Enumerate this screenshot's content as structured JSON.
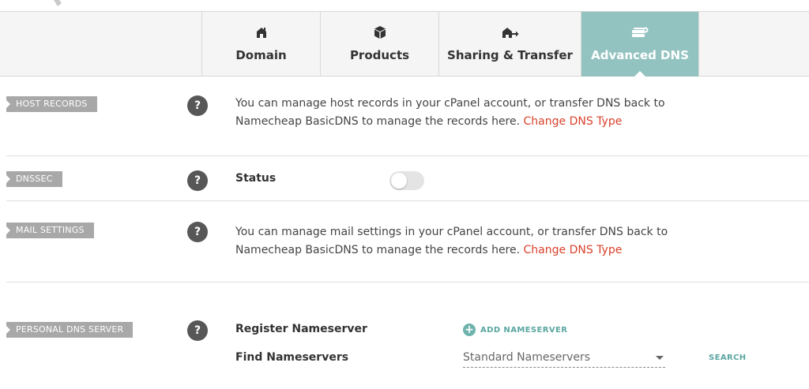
{
  "tabs": [
    {
      "label": "Domain",
      "icon": "house-icon"
    },
    {
      "label": "Products",
      "icon": "box-icon"
    },
    {
      "label": "Sharing & Transfer",
      "icon": "house-arrow-icon"
    },
    {
      "label": "Advanced DNS",
      "icon": "server-icon",
      "active": true
    }
  ],
  "host_records": {
    "tag": "HOST RECORDS",
    "help": "?",
    "text": "You can manage host records in your cPanel account, or transfer DNS back to Namecheap BasicDNS to manage the records here. ",
    "link": "Change DNS Type"
  },
  "dnssec": {
    "tag": "DNSSEC",
    "help": "?",
    "status_label": "Status",
    "enabled": false
  },
  "mail_settings": {
    "tag": "MAIL SETTINGS",
    "help": "?",
    "text": "You can manage mail settings in your cPanel account, or transfer DNS back to Namecheap BasicDNS to manage the records here. ",
    "link": "Change DNS Type"
  },
  "personal_dns": {
    "tag": "PERSONAL DNS SERVER",
    "help": "?",
    "register_label": "Register Nameserver",
    "add_button": "ADD NAMESERVER",
    "find_label": "Find Nameservers",
    "select_value": "Standard Nameservers",
    "search_button": "SEARCH"
  },
  "colors": {
    "active_tab": "#93c3c0",
    "link": "#d9412b",
    "accent": "#5aa6a1",
    "tag_bg": "#a8a8a8"
  }
}
